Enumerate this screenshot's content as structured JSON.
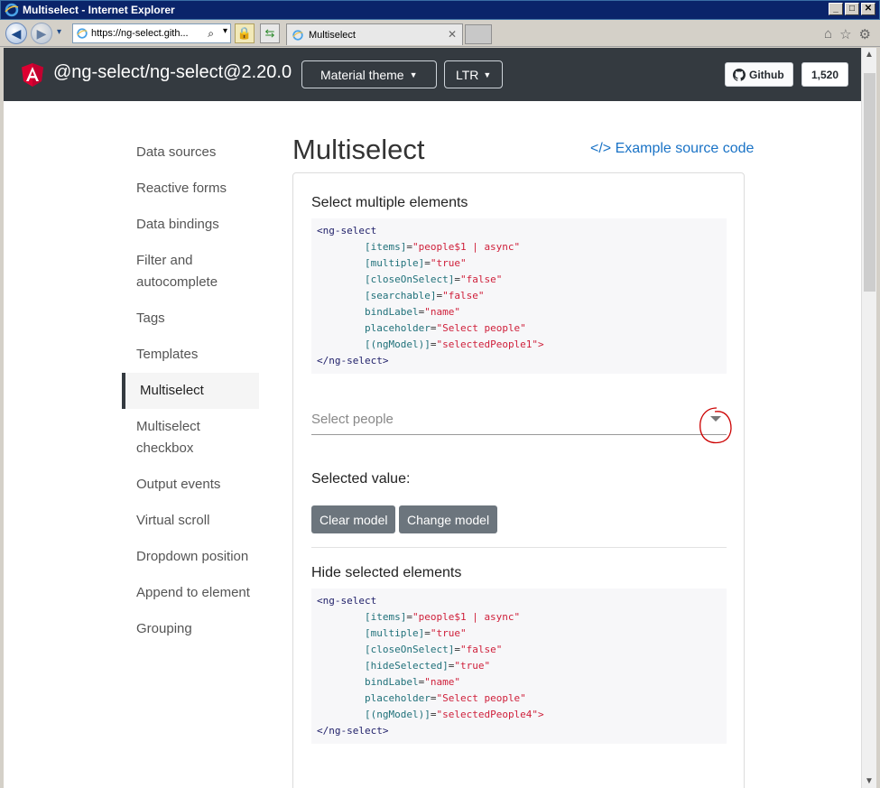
{
  "window": {
    "title": "Multiselect - Internet Explorer",
    "minimize": "_",
    "maximize": "□",
    "close": "✕"
  },
  "ie": {
    "url": "https://ng-select.gith...",
    "tab_title": "Multiselect",
    "tab_close": "✕",
    "back": "◀",
    "forward": "▶",
    "search_icon": "⌕",
    "dropdown": "▾",
    "lock": "🔒",
    "refresh": "⇆",
    "home": "⌂",
    "favorites": "☆",
    "settings": "⚙"
  },
  "header": {
    "brand": "@ng-select/ng-select@2.20.0",
    "theme_label": "Material theme",
    "dir_label": "LTR",
    "github_label": "Github",
    "github_count": "1,520",
    "caret": "▼"
  },
  "sidebar": {
    "items": [
      {
        "label": "Data sources"
      },
      {
        "label": "Reactive forms"
      },
      {
        "label": "Data bindings"
      },
      {
        "label": "Filter and autocomplete"
      },
      {
        "label": "Tags"
      },
      {
        "label": "Templates"
      },
      {
        "label": "Multiselect"
      },
      {
        "label": "Multiselect checkbox"
      },
      {
        "label": "Output events"
      },
      {
        "label": "Virtual scroll"
      },
      {
        "label": "Dropdown position"
      },
      {
        "label": "Append to element"
      },
      {
        "label": "Grouping"
      }
    ],
    "active_index": 6
  },
  "main": {
    "title": "Multiselect",
    "source_link": "</> Example source code",
    "section1": {
      "title": "Select multiple elements",
      "code": {
        "open": "<ng-select",
        "lines": [
          {
            "attr": "[items]",
            "eq": "=",
            "val": "\"people$1 | async\""
          },
          {
            "attr": "[multiple]",
            "eq": "=",
            "val": "\"true\""
          },
          {
            "attr": "[closeOnSelect]",
            "eq": "=",
            "val": "\"false\""
          },
          {
            "attr": "[searchable]",
            "eq": "=",
            "val": "\"false\""
          },
          {
            "attr": "bindLabel",
            "eq": "=",
            "val": "\"name\""
          },
          {
            "attr": "placeholder",
            "eq": "=",
            "val": "\"Select people\""
          },
          {
            "attr": "[(ngModel)]",
            "eq": "=",
            "val": "\"selectedPeople1\">"
          }
        ],
        "close": "</ng-select>"
      },
      "placeholder": "Select people",
      "selected_label": "Selected value:",
      "clear_button": "Clear model",
      "change_button": "Change model"
    },
    "section2": {
      "title": "Hide selected elements",
      "code": {
        "open": "<ng-select",
        "lines": [
          {
            "attr": "[items]",
            "eq": "=",
            "val": "\"people$1 | async\""
          },
          {
            "attr": "[multiple]",
            "eq": "=",
            "val": "\"true\""
          },
          {
            "attr": "[closeOnSelect]",
            "eq": "=",
            "val": "\"false\""
          },
          {
            "attr": "[hideSelected]",
            "eq": "=",
            "val": "\"true\""
          },
          {
            "attr": "bindLabel",
            "eq": "=",
            "val": "\"name\""
          },
          {
            "attr": "placeholder",
            "eq": "=",
            "val": "\"Select people\""
          },
          {
            "attr": "[(ngModel)]",
            "eq": "=",
            "val": "\"selectedPeople4\">"
          }
        ],
        "close": "</ng-select>"
      }
    }
  },
  "colors": {
    "topbar": "#343a40",
    "link": "#1a73c6",
    "button": "#6c757d",
    "annotation": "#cc0000"
  }
}
